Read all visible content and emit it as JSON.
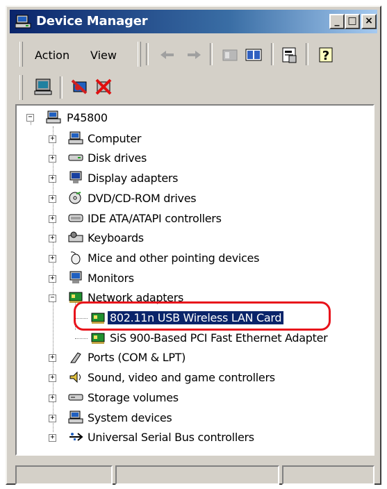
{
  "window": {
    "title": "Device Manager",
    "controls": {
      "minimize": "_",
      "maximize": "□",
      "close": "×"
    }
  },
  "menu": {
    "items": [
      {
        "label": "Action",
        "underline": "A"
      },
      {
        "label": "View",
        "underline": "V"
      }
    ]
  },
  "toolbar": {
    "buttons": [
      "back-icon",
      "forward-icon",
      "up-icon",
      "properties-view-icon",
      "properties-icon",
      "help-icon"
    ]
  },
  "toolbar2": {
    "buttons": [
      "scan-hardware-icon",
      "uninstall-icon",
      "disable-icon"
    ]
  },
  "tree": {
    "root": "P45800",
    "categories": [
      {
        "label": "Computer",
        "icon": "computer-icon",
        "expanded": false
      },
      {
        "label": "Disk drives",
        "icon": "disk-drive-icon",
        "expanded": false
      },
      {
        "label": "Display adapters",
        "icon": "display-icon",
        "expanded": false
      },
      {
        "label": "DVD/CD-ROM drives",
        "icon": "cdrom-icon",
        "expanded": false
      },
      {
        "label": "IDE ATA/ATAPI controllers",
        "icon": "ide-icon",
        "expanded": false
      },
      {
        "label": "Keyboards",
        "icon": "keyboard-icon",
        "expanded": false
      },
      {
        "label": "Mice and other pointing devices",
        "icon": "mouse-icon",
        "expanded": false
      },
      {
        "label": "Monitors",
        "icon": "monitor-icon",
        "expanded": false
      },
      {
        "label": "Network adapters",
        "icon": "network-adapter-icon",
        "expanded": true,
        "children": [
          {
            "label": "802.11n USB Wireless LAN Card",
            "selected": true
          },
          {
            "label": "SiS 900-Based PCI Fast Ethernet Adapter",
            "selected": false
          }
        ]
      },
      {
        "label": "Ports (COM & LPT)",
        "icon": "port-icon",
        "expanded": false
      },
      {
        "label": "Sound, video and game controllers",
        "icon": "sound-icon",
        "expanded": false
      },
      {
        "label": "Storage volumes",
        "icon": "storage-icon",
        "expanded": false
      },
      {
        "label": "System devices",
        "icon": "system-icon",
        "expanded": false
      },
      {
        "label": "Universal Serial Bus controllers",
        "icon": "usb-icon",
        "expanded": false
      }
    ]
  },
  "colors": {
    "titlebar_start": "#0a246a",
    "titlebar_end": "#a6caf0",
    "selection": "#0a246a",
    "highlight_ring": "#e8121b",
    "chrome": "#d4d0c8"
  }
}
